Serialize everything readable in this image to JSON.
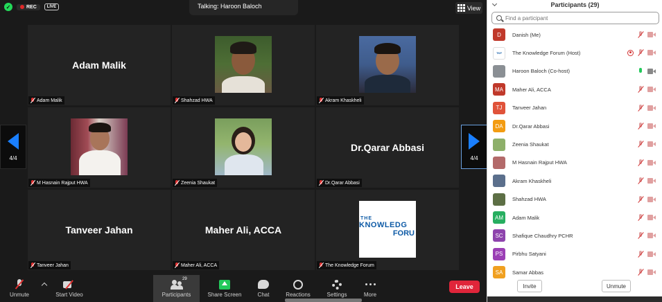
{
  "header": {
    "rec_label": "REC",
    "live_label": "LIVE",
    "talking": "Talking: Haroon Baloch",
    "view_label": "View"
  },
  "pager": {
    "left": "4/4",
    "right": "4/4"
  },
  "tiles": [
    {
      "name": "Adam Malik",
      "label": "Adam Malik"
    },
    {
      "name": "Shahzad HWA",
      "label": "Shahzad HWA"
    },
    {
      "name": "Akram Khaskheli",
      "label": "Akram Khaskheli"
    },
    {
      "name": "M Hasnain Rajput HWA",
      "label": "M Hasnain Rajput HWA"
    },
    {
      "name": "Zeenia Shaukat",
      "label": "Zeenia Shaukat"
    },
    {
      "name": "Dr.Qarar Abbasi",
      "label": "Dr.Qarar Abbasi"
    },
    {
      "name": "Tanveer Jahan",
      "label": "Tanveer Jahan"
    },
    {
      "name": "Maher Ali, ACCA",
      "label": "Maher Ali, ACCA"
    },
    {
      "name": "The Knowledge Forum",
      "label": "The Knowledge Forum"
    }
  ],
  "logo": {
    "the": "THE",
    "knowledge": "KNOWLEDG",
    "forum": "FORU"
  },
  "toolbar": {
    "unmute": "Unmute",
    "start_video": "Start Video",
    "participants": "Participants",
    "participants_count": "29",
    "share_screen": "Share Screen",
    "chat": "Chat",
    "reactions": "Reactions",
    "settings": "Settings",
    "more": "More",
    "leave": "Leave"
  },
  "panel": {
    "title": "Participants (29)",
    "search_placeholder": "Find a participant",
    "invite": "Invite",
    "unmute": "Unmute",
    "participants": [
      {
        "initials": "D",
        "name": "Danish (Me)",
        "color": "#c0392b"
      },
      {
        "initials": "",
        "name": "The Knowledge Forum (Host)",
        "color": "#ffffff"
      },
      {
        "initials": "",
        "name": "Haroon Baloch (Co-host)",
        "color": "#8a8f94"
      },
      {
        "initials": "MA",
        "name": "Maher Ali, ACCA",
        "color": "#c0392b"
      },
      {
        "initials": "TJ",
        "name": "Tanveer Jahan",
        "color": "#e0533a"
      },
      {
        "initials": "DA",
        "name": "Dr.Qarar Abbasi",
        "color": "#f39c12"
      },
      {
        "initials": "",
        "name": "Zeenia Shaukat",
        "color": "#8eb06a"
      },
      {
        "initials": "",
        "name": "M Hasnain Rajput HWA",
        "color": "#b36a6a"
      },
      {
        "initials": "",
        "name": "Akram Khaskheli",
        "color": "#5b6f8c"
      },
      {
        "initials": "",
        "name": "Shahzad HWA",
        "color": "#5d6f45"
      },
      {
        "initials": "AM",
        "name": "Adam Malik",
        "color": "#27ae60"
      },
      {
        "initials": "SC",
        "name": "Shafique Chaudhry PCHR",
        "color": "#8e44ad"
      },
      {
        "initials": "PS",
        "name": "Pirbhu Satyani",
        "color": "#9b3fb5"
      },
      {
        "initials": "SA",
        "name": "Samar Abbas",
        "color": "#f0a020"
      }
    ]
  }
}
